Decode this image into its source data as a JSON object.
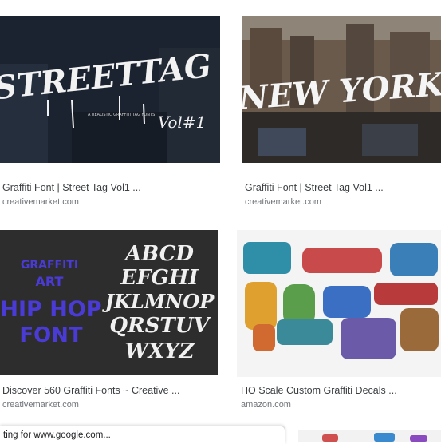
{
  "results": [
    {
      "title": "Graffiti Font | Street Tag Vol1 ...",
      "source": "creativemarket.com",
      "art_main": "STREETTAG",
      "art_sub": "Vol#1",
      "art_small": "A REALISTIC GRAFFITI TAG FONTS",
      "colors": {
        "bg": "#1b2330",
        "ink": "#f2f2f2"
      }
    },
    {
      "title": "Graffiti Font | Street Tag Vol1 ...",
      "source": "creativemarket.com",
      "art_main": "NEW YORK",
      "colors": {
        "bg": "#4a4038",
        "ink": "#f5f5f5"
      }
    },
    {
      "title": "Discover 560 Graffiti Fonts ~ Creative ...",
      "source": "creativemarket.com",
      "art_left_1": "GRAFFITI",
      "art_left_2": "ART",
      "art_left_3": "HIP HOP",
      "art_left_4": "FONT",
      "art_right_1": "ABCD",
      "art_right_2": "EFGHI",
      "art_right_3": "JKLMNOP",
      "art_right_4": "QRSTUV",
      "art_right_5": "WXYZ",
      "colors": {
        "bg": "#2d2d2d",
        "purple": "#4b3bd6",
        "ink": "#f0f0f0"
      }
    },
    {
      "title": "HO Scale Custom Graffiti Decals ...",
      "source": "amazon.com",
      "colors": {
        "bg": "#ffffff"
      }
    }
  ],
  "status_bar": {
    "text": "ting for www.google.com..."
  }
}
